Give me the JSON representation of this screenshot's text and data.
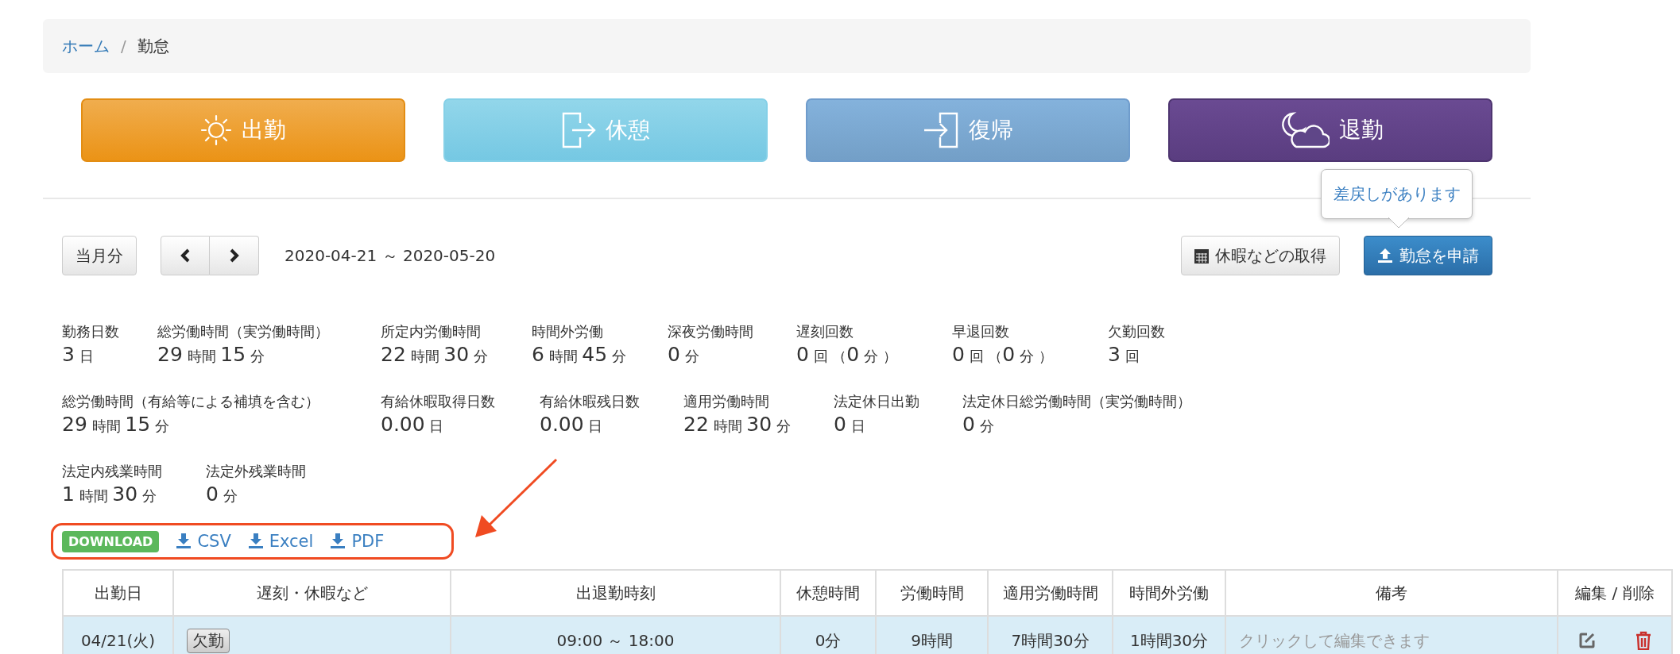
{
  "breadcrumb": {
    "items": [
      {
        "label": "ホーム",
        "link": true
      },
      {
        "label": "勤怠",
        "link": false
      }
    ],
    "separator": "/"
  },
  "punch_buttons": [
    {
      "label": "出勤",
      "kind": "sun"
    },
    {
      "label": "休憩",
      "kind": "exit"
    },
    {
      "label": "復帰",
      "kind": "enter"
    },
    {
      "label": "退勤",
      "kind": "moon"
    }
  ],
  "toolbar": {
    "current_month": "当月分",
    "period": "2020-04-21 ～ 2020-05-20",
    "leave_button": "休暇などの取得",
    "apply_button": "勤怠を申請",
    "tooltip": "差戻しがあります"
  },
  "summary": [
    [
      {
        "label": "勤務日数",
        "value": "3 日"
      },
      {
        "label": "総労働時間（実労働時間）",
        "value": "29 時間 15 分"
      },
      {
        "label": "所定内労働時間",
        "value": "22 時間 30 分"
      },
      {
        "label": "時間外労働",
        "value": "6 時間 45 分"
      },
      {
        "label": "深夜労働時間",
        "value": "0 分"
      },
      {
        "label": "遅刻回数",
        "value": "0 回 （0 分 ）"
      },
      {
        "label": "早退回数",
        "value": "0 回 （0 分 ）"
      },
      {
        "label": "欠勤回数",
        "value": "3 回"
      }
    ],
    [
      {
        "label": "総労働時間（有給等による補填を含む）",
        "value": "29 時間 15 分"
      },
      {
        "label": "有給休暇取得日数",
        "value": "0.00 日"
      },
      {
        "label": "有給休暇残日数",
        "value": "0.00 日"
      },
      {
        "label": "適用労働時間",
        "value": "22 時間 30 分"
      },
      {
        "label": "法定休日出勤",
        "value": "0 日"
      },
      {
        "label": "法定休日総労働時間（実労働時間）",
        "value": "0 分"
      }
    ],
    [
      {
        "label": "法定内残業時間",
        "value": "1 時間 30 分"
      },
      {
        "label": "法定外残業時間",
        "value": "0 分"
      }
    ]
  ],
  "download": {
    "badge": "DOWNLOAD",
    "links": [
      "CSV",
      "Excel",
      "PDF"
    ]
  },
  "table": {
    "columns": [
      "出勤日",
      "遅刻・休暇など",
      "出退勤時刻",
      "休憩時間",
      "労働時間",
      "適用労働時間",
      "時間外労働",
      "備考",
      "編集 / 削除"
    ],
    "rows": [
      {
        "date": "04/21(火)",
        "tag": "欠勤",
        "times": "09:00 ～ 18:00",
        "break": "0分",
        "work": "9時間",
        "applied": "7時間30分",
        "overtime": "1時間30分",
        "note": {
          "placeholder": "クリックして編集できます"
        }
      }
    ]
  }
}
